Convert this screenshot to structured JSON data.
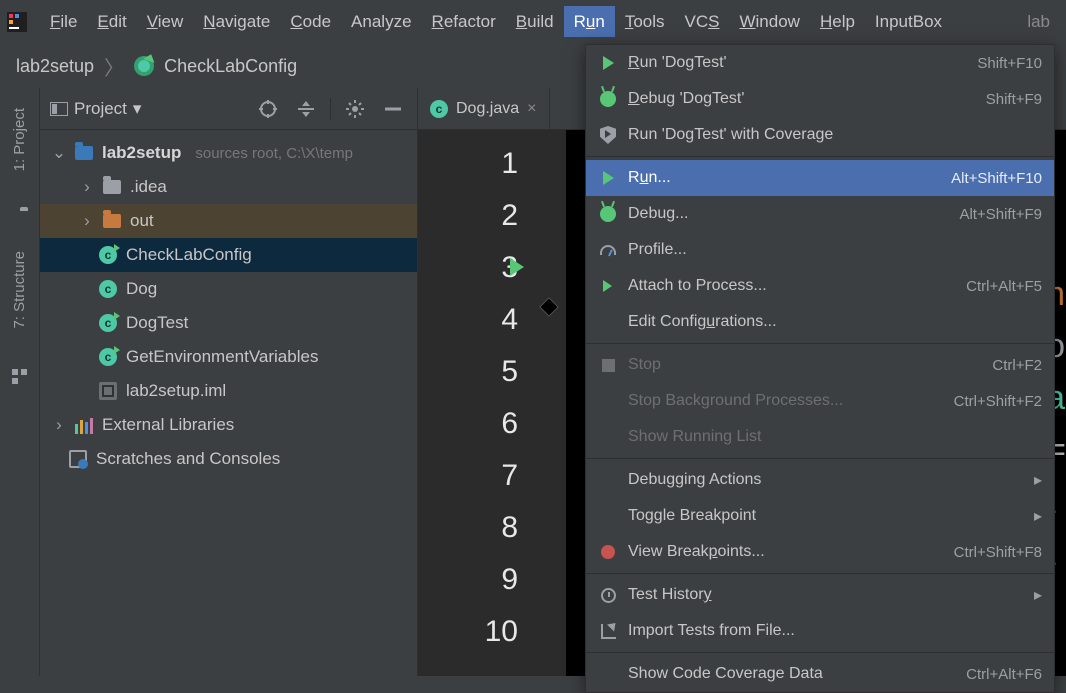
{
  "menubar": {
    "items": [
      {
        "label": "File",
        "ul": "F"
      },
      {
        "label": "Edit",
        "ul": "E"
      },
      {
        "label": "View",
        "ul": "V"
      },
      {
        "label": "Navigate",
        "ul": "N"
      },
      {
        "label": "Code",
        "ul": "C"
      },
      {
        "label": "Analyze",
        "ul": ""
      },
      {
        "label": "Refactor",
        "ul": "R"
      },
      {
        "label": "Build",
        "ul": "B"
      },
      {
        "label": "Run",
        "ul": "u",
        "active": true
      },
      {
        "label": "Tools",
        "ul": "T"
      },
      {
        "label": "VCS",
        "ul": "S"
      },
      {
        "label": "Window",
        "ul": "W"
      },
      {
        "label": "Help",
        "ul": "H"
      },
      {
        "label": "InputBox",
        "ul": ""
      }
    ],
    "right": "lab"
  },
  "breadcrumb": {
    "root": "lab2setup",
    "leaf": "CheckLabConfig"
  },
  "sidebar_labels": {
    "project": "1: Project",
    "structure": "7: Structure"
  },
  "panel": {
    "title": "Project"
  },
  "tree": {
    "root": "lab2setup",
    "root_suffix": "sources root,  C:\\X\\temp",
    "idea": ".idea",
    "out": "out",
    "checklab": "CheckLabConfig",
    "dog": "Dog",
    "dogtest": "DogTest",
    "getenv": "GetEnvironmentVariables",
    "iml": "lab2setup.iml",
    "extlib": "External Libraries",
    "scratches": "Scratches and Consoles"
  },
  "editor": {
    "tab_label": "Dog.java",
    "line_numbers": [
      "1",
      "2",
      "3",
      "4",
      "5",
      "6",
      "7",
      "8",
      "9",
      "10"
    ]
  },
  "dropdown": [
    {
      "icon": "play",
      "label": "Run 'DogTest'",
      "ul": "R",
      "shortcut": "Shift+F10"
    },
    {
      "icon": "bug",
      "label": "Debug 'DogTest'",
      "ul": "D",
      "shortcut": "Shift+F9"
    },
    {
      "icon": "shield",
      "label": "Run 'DogTest' with Coverage",
      "ul": "",
      "shortcut": ""
    },
    {
      "sep": true
    },
    {
      "icon": "play",
      "label": "Run...",
      "ul": "u",
      "shortcut": "Alt+Shift+F10",
      "selected": true
    },
    {
      "icon": "bug",
      "label": "Debug...",
      "ul": "",
      "shortcut": "Alt+Shift+F9"
    },
    {
      "icon": "gauge",
      "label": "Profile...",
      "ul": "",
      "shortcut": ""
    },
    {
      "icon": "attach",
      "label": "Attach to Process...",
      "ul": "",
      "shortcut": "Ctrl+Alt+F5"
    },
    {
      "icon": "",
      "label": "Edit Configurations...",
      "ul": "u",
      "shortcut": ""
    },
    {
      "sep": true
    },
    {
      "icon": "stop",
      "label": "Stop",
      "ul": "",
      "shortcut": "Ctrl+F2",
      "disabled": true
    },
    {
      "icon": "",
      "label": "Stop Background Processes...",
      "ul": "",
      "shortcut": "Ctrl+Shift+F2",
      "disabled": true
    },
    {
      "icon": "",
      "label": "Show Running List",
      "ul": "",
      "shortcut": "",
      "disabled": true
    },
    {
      "sep": true
    },
    {
      "icon": "",
      "label": "Debugging Actions",
      "ul": "",
      "submenu": true
    },
    {
      "icon": "",
      "label": "Toggle Breakpoint",
      "ul": "",
      "submenu": true
    },
    {
      "icon": "red",
      "label": "View Breakpoints...",
      "ul": "p",
      "shortcut": "Ctrl+Shift+F8"
    },
    {
      "sep": true
    },
    {
      "icon": "clock",
      "label": "Test History",
      "ul": "y",
      "submenu": true
    },
    {
      "icon": "import",
      "label": "Import Tests from File...",
      "ul": "",
      "shortcut": ""
    },
    {
      "sep": true
    },
    {
      "icon": "",
      "label": "Show Code Coverage Data",
      "ul": "",
      "shortcut": "Ctrl+Alt+F6"
    }
  ]
}
